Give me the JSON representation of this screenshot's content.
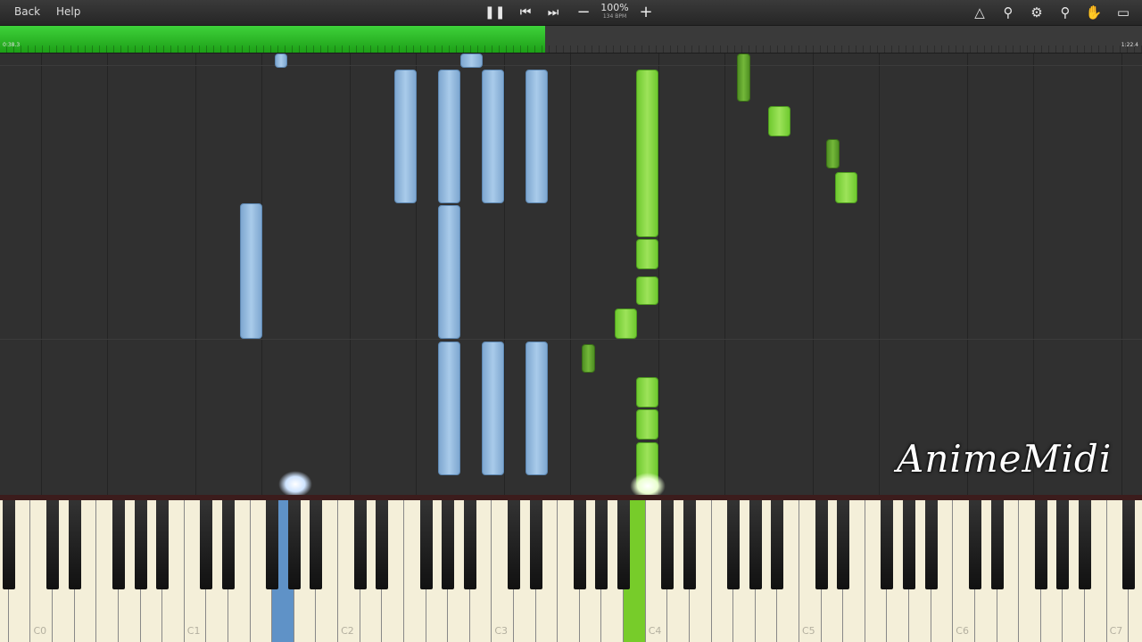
{
  "toolbar": {
    "back_label": "Back",
    "help_label": "Help",
    "zoom": "100%",
    "bpm": "134 BPM",
    "play_icon": "pause-icon",
    "prev_icon": "skip-back-icon",
    "next_icon": "skip-forward-icon",
    "zoom_out_icon": "minus-icon",
    "zoom_in_icon": "plus-icon",
    "right_icons": [
      "metronome-icon",
      "search-icon",
      "settings-icon",
      "marker-icon",
      "hand-icon",
      "loop-icon"
    ]
  },
  "progress": {
    "elapsed": "0:38.3",
    "total": "1:22.4",
    "fraction": 0.477,
    "color": "#2eb82a"
  },
  "keyboard": {
    "labels": [
      "C0",
      "C1",
      "C2",
      "C3",
      "C4",
      "C5",
      "C6",
      "C7"
    ],
    "active_colors": {
      "left_hand": "#6a9fd4",
      "right_hand": "#7ed321"
    }
  },
  "watermark": "AnimeMidi"
}
